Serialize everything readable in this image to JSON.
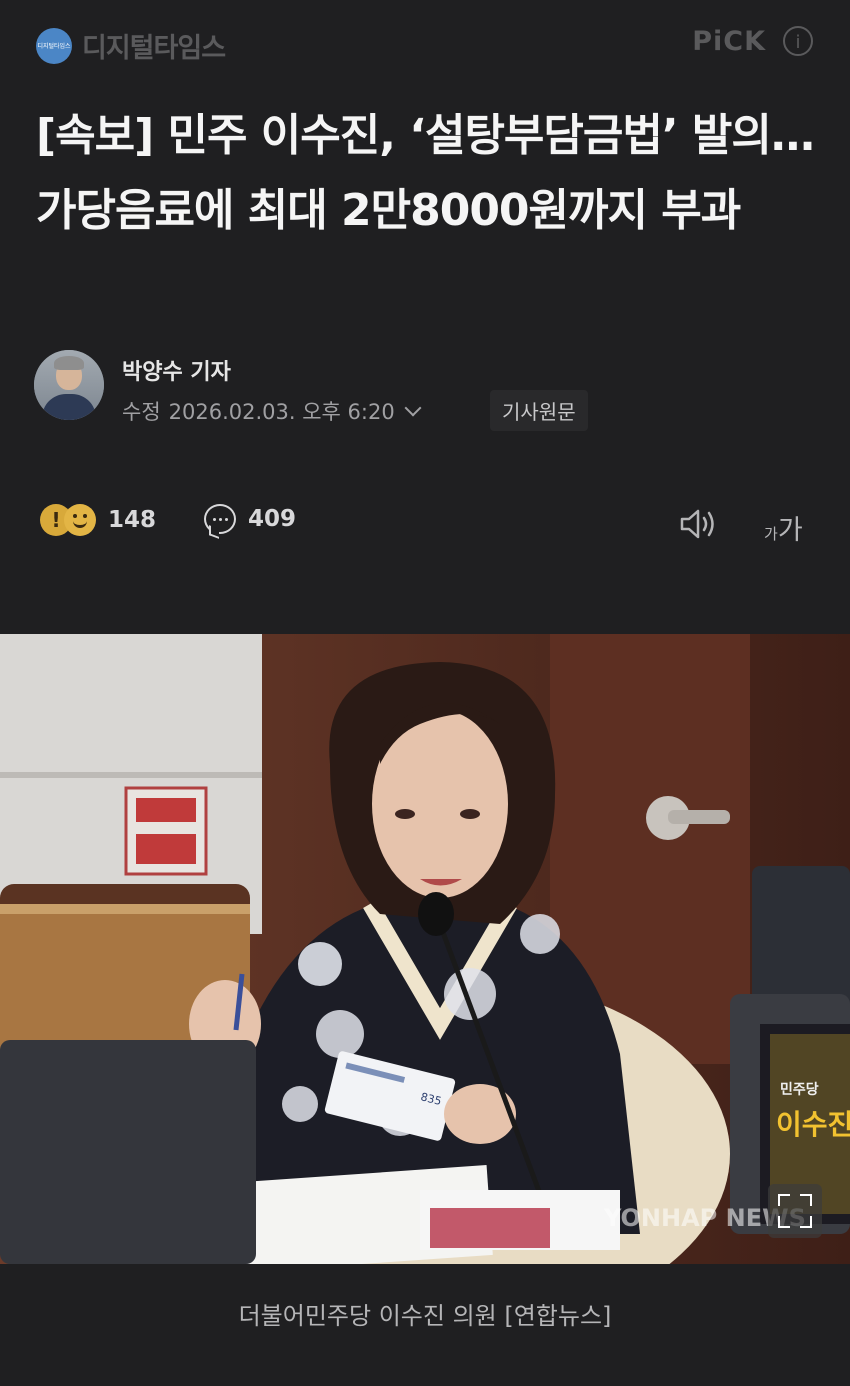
{
  "press": {
    "name": "디지털타임스",
    "logo_small_text": "디지털타임스"
  },
  "header": {
    "pick_label": "PiCK",
    "info_icon": "info-icon"
  },
  "article": {
    "title": "[속보] 민주 이수진, ‘설탕부담금법’ 발의…가당음료에 최대 2만8000원까지 부과"
  },
  "byline": {
    "reporter": "박양수 기자",
    "date_label": "수정",
    "date": "2026.02.03. 오후 6:20",
    "original_button": "기사원문"
  },
  "actions": {
    "reaction_count": "148",
    "comment_count": "409",
    "font_small": "가",
    "font_big": "가",
    "icons": [
      "surprise-emoji-icon",
      "smile-emoji-icon",
      "comment-icon",
      "speaker-icon"
    ]
  },
  "photo": {
    "watermark": "YONHAP NEWS",
    "placard_line1": "민주당",
    "placard_line2": "이수진",
    "document_text": "835",
    "caption": "더불어민주당 이수진 의원 [연합뉴스]"
  },
  "colors": {
    "background": "#1f1f21",
    "text": "#f2f2f2",
    "muted": "#a0a0a3",
    "logo_blue": "#4b86c6",
    "reaction_yellow": "#e3b545"
  }
}
